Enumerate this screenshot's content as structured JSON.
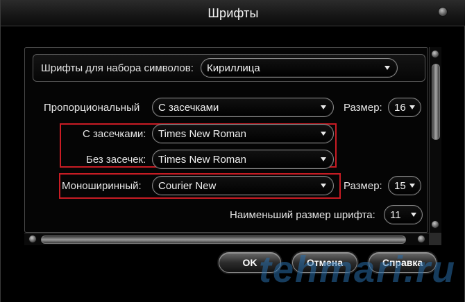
{
  "window": {
    "title": "Шрифты"
  },
  "charset": {
    "label": "Шрифты для набора символов:",
    "value": "Кириллица"
  },
  "proportional": {
    "label": "Пропорциональный",
    "value": "С засечками",
    "size_label": "Размер:",
    "size_value": "16"
  },
  "serif": {
    "label": "С засечками:",
    "value": "Times New Roman"
  },
  "sans_serif": {
    "label": "Без засечек:",
    "value": "Times New Roman"
  },
  "monospace": {
    "label": "Моноширинный:",
    "value": "Courier New",
    "size_label": "Размер:",
    "size_value": "15"
  },
  "min_size": {
    "label": "Наименьший размер шрифта:",
    "value": "11"
  },
  "buttons": {
    "ok": "OK",
    "cancel": "Отмена",
    "help": "Справка"
  },
  "watermark": "tehmari.ru",
  "colors": {
    "highlight": "#c91c24",
    "background": "#000000"
  }
}
